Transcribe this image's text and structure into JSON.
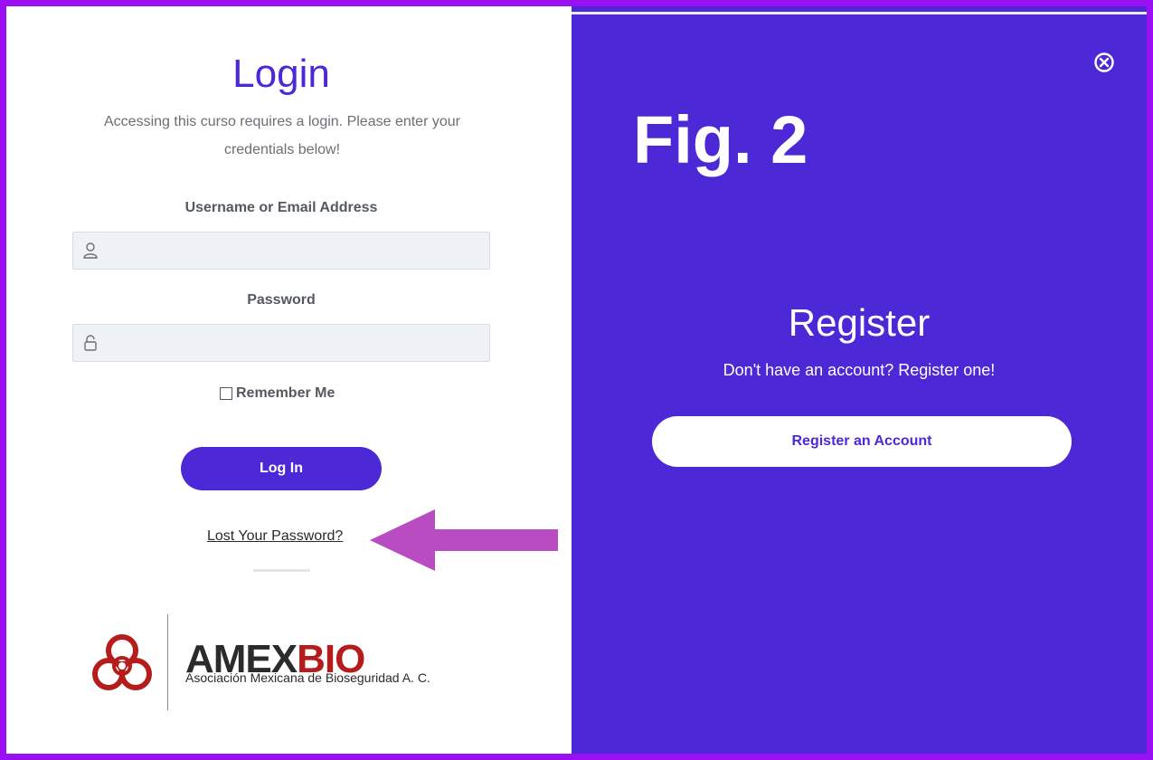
{
  "login": {
    "title": "Login",
    "subtitle": "Accessing this curso requires a login. Please enter your credentials below!",
    "username_label": "Username or Email Address",
    "username_value": "",
    "password_label": "Password",
    "password_value": "",
    "remember_label": "Remember Me",
    "remember_checked": false,
    "login_button": "Log In",
    "lost_password": "Lost Your Password?"
  },
  "logo": {
    "name_part1": "AMEX",
    "name_part2": "BIO",
    "tagline": "Asociación Mexicana de Bioseguridad A. C.",
    "icon": "biohazard-icon"
  },
  "register": {
    "figure_label": "Fig. 2",
    "title": "Register",
    "subtitle": "Don't have an account? Register one!",
    "button": "Register an Account"
  },
  "icons": {
    "username": "user-icon",
    "password": "lock-icon",
    "close": "close-circle-icon",
    "annotation": "arrow-left-icon"
  },
  "colors": {
    "brand": "#4d28d6",
    "frame": "#9b10f2",
    "arrow": "#b84cc0",
    "logo_red": "#b51c1c"
  }
}
